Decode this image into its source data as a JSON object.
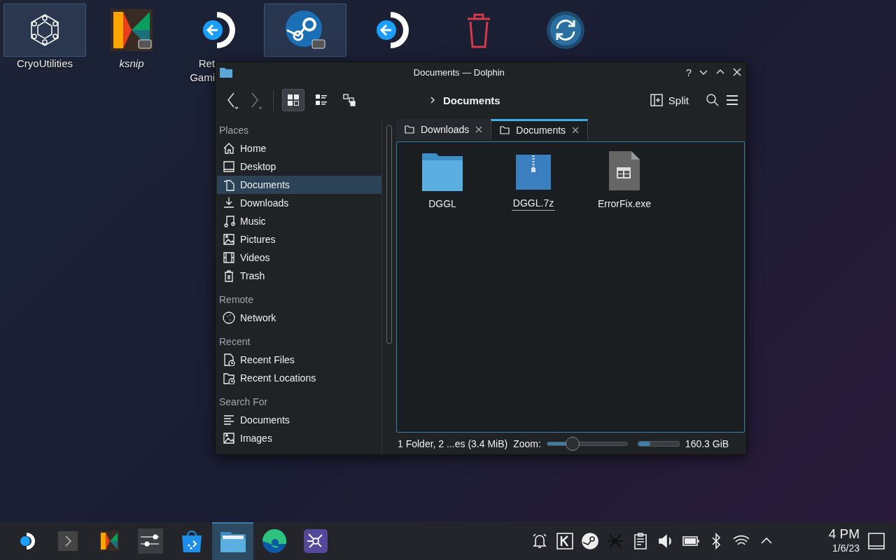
{
  "desktop_icons": [
    {
      "kind": "cryo",
      "label": [
        "CryoUtilities"
      ],
      "selected": true,
      "italic": false
    },
    {
      "kind": "ksnip",
      "label": [
        "ksnip"
      ],
      "selected": false,
      "italic": true
    },
    {
      "kind": "return",
      "label": [
        "Ret",
        "Gami"
      ],
      "selected": false,
      "italic": false
    },
    {
      "kind": "steam",
      "selected": true
    },
    {
      "kind": "return",
      "selected": false
    },
    {
      "kind": "trash",
      "selected": false
    },
    {
      "kind": "update",
      "selected": false
    }
  ],
  "window": {
    "title": "Documents — Dolphin",
    "controls": [
      "?"
    ],
    "view_modes": [
      {
        "kind": "icons",
        "selected": true
      },
      {
        "kind": "details",
        "selected": false
      },
      {
        "kind": "tree",
        "selected": false
      }
    ],
    "breadcrumb": "Documents",
    "split": "Split",
    "tabs": [
      {
        "label": "Downloads",
        "selected": false
      },
      {
        "label": "Documents",
        "selected": true
      }
    ],
    "places": [
      {
        "heading": "Places",
        "items": [
          {
            "kind": "home",
            "label": "Home",
            "selected": false
          },
          {
            "kind": "desktop",
            "label": "Desktop",
            "selected": false
          },
          {
            "kind": "documents",
            "label": "Documents",
            "selected": true
          },
          {
            "kind": "downloads",
            "label": "Downloads",
            "selected": false
          },
          {
            "kind": "music",
            "label": "Music",
            "selected": false
          },
          {
            "kind": "pictures",
            "label": "Pictures",
            "selected": false
          },
          {
            "kind": "videos",
            "label": "Videos",
            "selected": false
          },
          {
            "kind": "trash",
            "label": "Trash",
            "selected": false
          }
        ]
      },
      {
        "heading": "Remote",
        "items": [
          {
            "kind": "network",
            "label": "Network",
            "selected": false
          }
        ]
      },
      {
        "heading": "Recent",
        "items": [
          {
            "kind": "recent-files",
            "label": "Recent Files",
            "selected": false
          },
          {
            "kind": "recent-locations",
            "label": "Recent Locations",
            "selected": false
          }
        ]
      },
      {
        "heading": "Search For",
        "items": [
          {
            "kind": "text",
            "label": "Documents",
            "selected": false
          },
          {
            "kind": "pictures",
            "label": "Images",
            "selected": false
          }
        ]
      }
    ],
    "files": [
      {
        "kind": "folder",
        "name": "DGGL",
        "selected": false
      },
      {
        "kind": "archive",
        "name": "DGGL.7z",
        "selected": true
      },
      {
        "kind": "exe",
        "name": "ErrorFix.exe",
        "selected": false
      }
    ],
    "status": {
      "text": "1 Folder, 2 ...es (3.4 MiB)",
      "zoom_label": "Zoom:",
      "zoom": {
        "level": 0.28
      },
      "space": {
        "level": 0.3
      },
      "space_text": "160.3 GiB"
    }
  },
  "taskbar": {
    "apps": [
      {
        "kind": "launcher",
        "selected": false
      },
      {
        "kind": "terminal",
        "selected": false
      },
      {
        "kind": "ksnip",
        "selected": false
      },
      {
        "kind": "settings",
        "selected": false
      },
      {
        "kind": "store",
        "selected": false
      },
      {
        "kind": "files",
        "selected": true
      },
      {
        "kind": "browser",
        "selected": false
      },
      {
        "kind": "share",
        "selected": false
      }
    ],
    "time": "4 PM",
    "date": "1/6/23"
  }
}
